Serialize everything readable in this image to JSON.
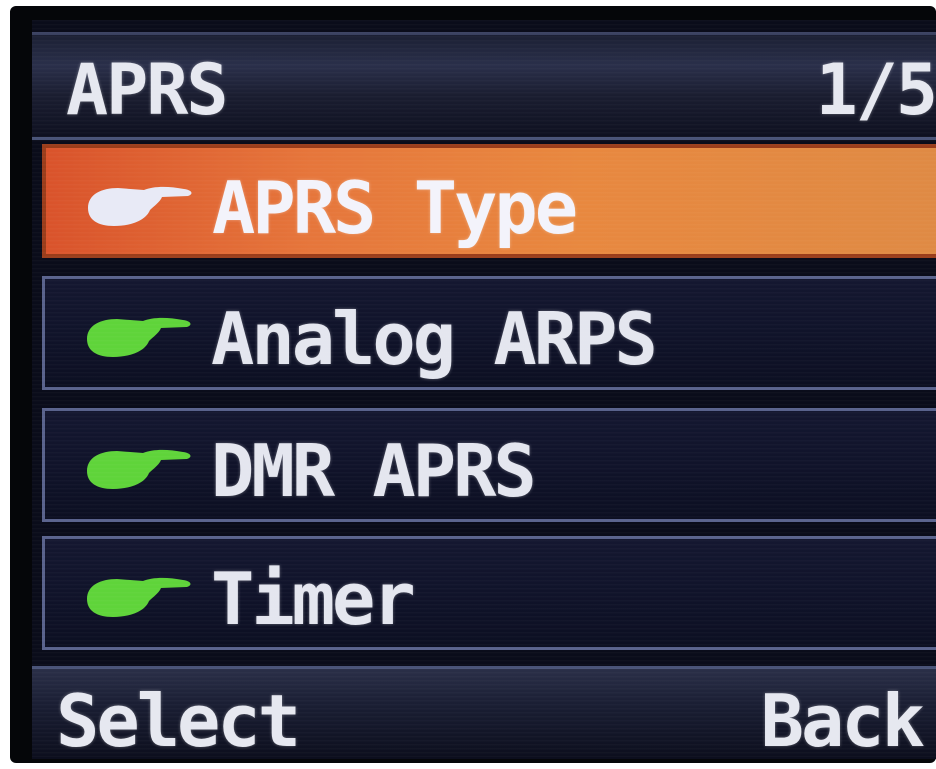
{
  "header": {
    "title": "APRS",
    "page": "1/5"
  },
  "menu": {
    "items": [
      {
        "label": "APRS Type",
        "icon": "pointing-hand-icon",
        "selected": true,
        "icon_color": "#e8eaf6"
      },
      {
        "label": "Analog ARPS",
        "icon": "pointing-hand-icon",
        "selected": false,
        "icon_color": "#5fd43a"
      },
      {
        "label": "DMR APRS",
        "icon": "pointing-hand-icon",
        "selected": false,
        "icon_color": "#5fd43a"
      },
      {
        "label": "Timer",
        "icon": "pointing-hand-icon",
        "selected": false,
        "icon_color": "#5fd43a"
      }
    ]
  },
  "softkeys": {
    "left": "Select",
    "right": "Back"
  },
  "colors": {
    "selected_bg": "#e6763b",
    "item_bg": "#10132a",
    "text": "#e6e8f0",
    "screen_bg": "#0a0c1a"
  }
}
